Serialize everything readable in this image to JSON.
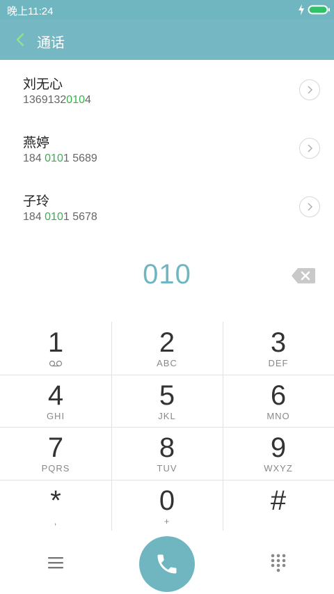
{
  "status_bar": {
    "time": "晚上11:24",
    "battery_color": "#2ec36b"
  },
  "app_bar": {
    "title": "通话"
  },
  "contacts": [
    {
      "name": "刘无心",
      "number_parts": [
        "1369132",
        "010",
        "4"
      ]
    },
    {
      "name": "燕婷",
      "number_parts": [
        "184 ",
        "010",
        "1 5689"
      ]
    },
    {
      "name": "子玲",
      "number_parts": [
        "184 ",
        "010",
        "1 5678"
      ]
    }
  ],
  "dialed": {
    "number": "010"
  },
  "keypad": {
    "keys": [
      {
        "digit": "1",
        "sub": "",
        "sub_icon": "voicemail-icon"
      },
      {
        "digit": "2",
        "sub": "ABC"
      },
      {
        "digit": "3",
        "sub": "DEF"
      },
      {
        "digit": "4",
        "sub": "GHI"
      },
      {
        "digit": "5",
        "sub": "JKL"
      },
      {
        "digit": "6",
        "sub": "MNO"
      },
      {
        "digit": "7",
        "sub": "PQRS"
      },
      {
        "digit": "8",
        "sub": "TUV"
      },
      {
        "digit": "9",
        "sub": "WXYZ"
      },
      {
        "digit": "*",
        "sub": ","
      },
      {
        "digit": "0",
        "sub": "+"
      },
      {
        "digit": "#",
        "sub": ""
      }
    ]
  },
  "colors": {
    "accent": "#6fb6c1",
    "match": "#35b34a",
    "app_bar": "#75b8c3"
  }
}
